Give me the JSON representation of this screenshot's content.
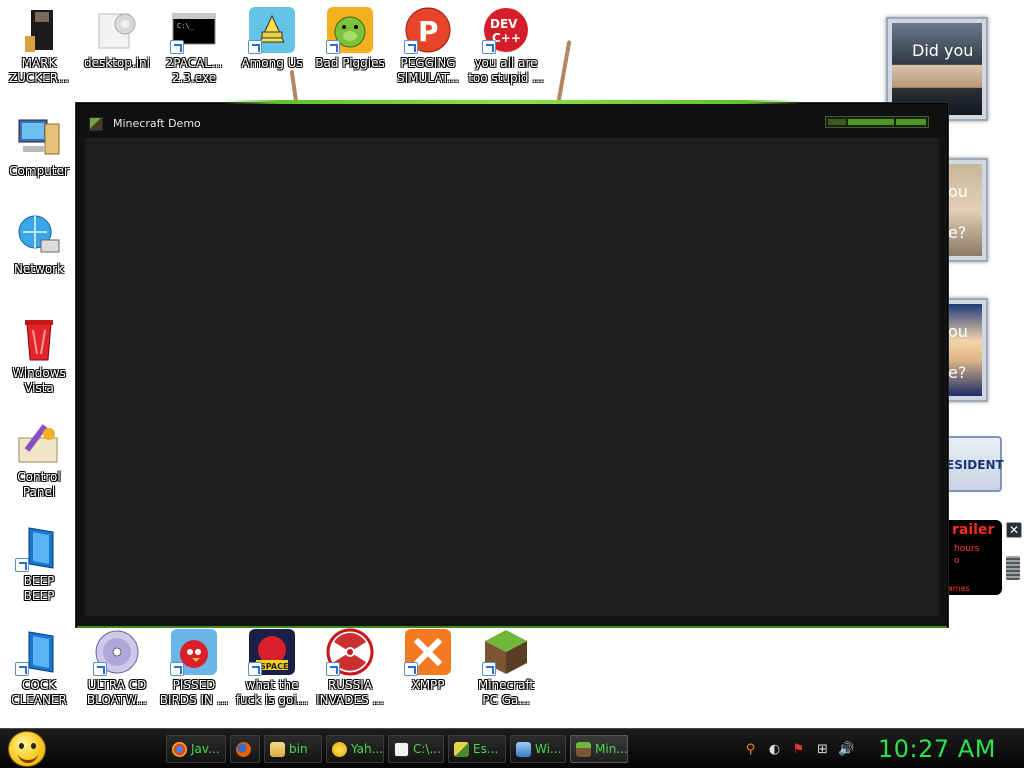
{
  "desktop": {
    "top_row": [
      {
        "label": "MARK\nZUCKER...",
        "icon": "mark-zuckerberg-icon"
      },
      {
        "label": "desktop.ini",
        "icon": "settings-file-icon"
      },
      {
        "label": "2PACAL...\n2.3.exe",
        "icon": "console-program-icon"
      },
      {
        "label": "Among Us",
        "icon": "among-us-icon"
      },
      {
        "label": "Bad Piggies",
        "icon": "bad-piggies-icon"
      },
      {
        "label": "PEGGING\nSIMULAT...",
        "icon": "pegging-simulator-icon"
      },
      {
        "label": "you all are\ntoo stupid ...",
        "icon": "dev-cpp-icon"
      }
    ],
    "left_column": [
      {
        "label": "Computer",
        "icon": "computer-icon"
      },
      {
        "label": "Network",
        "icon": "network-icon"
      },
      {
        "label": "Windows\nVista",
        "icon": "recycle-bin-icon"
      },
      {
        "label": "Control\nPanel",
        "icon": "control-panel-icon"
      },
      {
        "label": "BEEP\nBEEP",
        "icon": "beep-beep-icon"
      }
    ],
    "bottom_row": [
      {
        "label": "COCK\nCLEANER",
        "icon": "cleaner-icon"
      },
      {
        "label": "ULTRA CD\nBLOATW...",
        "icon": "cd-burner-icon"
      },
      {
        "label": "PISSED\nBIRDS IN ...",
        "icon": "angry-birds-icon"
      },
      {
        "label": "what the\nfuck is goi...",
        "icon": "angry-birds-space-icon"
      },
      {
        "label": "RUSSIA\nINVADES ...",
        "icon": "radiation-icon"
      },
      {
        "label": "XMPP",
        "icon": "xampp-icon"
      },
      {
        "label": "Minecraft\nPC Ga...",
        "icon": "minecraft-icon"
      }
    ]
  },
  "gadgets": {
    "photo_captions": [
      "Did you",
      "ou",
      "e?",
      "ou",
      "e?"
    ],
    "president_text": "ESIDENT",
    "trailer": {
      "title": "railer",
      "line1": "hours",
      "line2": "o",
      "footer": "ames"
    },
    "close_glyph": "✕"
  },
  "window": {
    "title": "Minecraft Demo"
  },
  "taskbar": {
    "items": [
      {
        "label": "Jav...",
        "icon": "chrome-icon",
        "color": "#db4437"
      },
      {
        "label": "",
        "icon": "firefox-icon",
        "color": "#e66000"
      },
      {
        "label": "bin",
        "icon": "folder-icon",
        "color": "#e8c66a"
      },
      {
        "label": "Yah...",
        "icon": "yahoo-messenger-icon",
        "color": "#f5c518"
      },
      {
        "label": "C:\\...",
        "icon": "7zip-icon",
        "color": "#dddddd"
      },
      {
        "label": "Es...",
        "icon": "editor-icon",
        "color": "#e3d34a"
      },
      {
        "label": "Wi...",
        "icon": "network-share-icon",
        "color": "#6aa6e8"
      },
      {
        "label": "Min...",
        "icon": "minecraft-icon",
        "color": "#6fa83a"
      }
    ],
    "tray_glyphs": [
      "⚲",
      "◐",
      "⚑",
      "⊞",
      "🔊"
    ],
    "clock": "10:27 AM"
  }
}
